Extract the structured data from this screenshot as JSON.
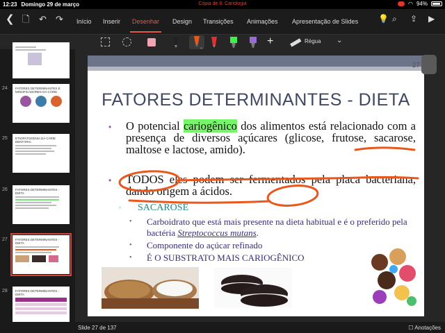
{
  "status": {
    "time": "12:23",
    "date": "Domingo 29 de março",
    "doc_title": "Cópia de 8. Cariologia",
    "battery": "94%"
  },
  "ribbon": {
    "tabs": [
      "Início",
      "Inserir",
      "Desenhar",
      "Design",
      "Transições",
      "Animações",
      "Apresentação de Slides"
    ],
    "active_tab": "Desenhar"
  },
  "toolbar": {
    "ruler_label": "Régua"
  },
  "thumbnails": [
    {
      "num": "",
      "title": "",
      "selected": false
    },
    {
      "num": "24",
      "title": "FATORES DETERMINANTES E MODIFICADORES DA CÁRIE",
      "selected": false
    },
    {
      "num": "25",
      "title": "ETIOPATOGENIA DA CÁRIE DENTÁRIA",
      "selected": false
    },
    {
      "num": "26",
      "title": "FATORES DETERMINANTES - DIETA",
      "selected": false
    },
    {
      "num": "27",
      "title": "FATORES DETERMINANTES - DIETA",
      "selected": true
    },
    {
      "num": "28",
      "title": "FATORES DETERMINANTES - DIETA",
      "selected": false
    }
  ],
  "slide": {
    "number": "27",
    "title": "FATORES DETERMINANTES - DIETA",
    "p1_before": "O potencial ",
    "p1_highlight": "cariogênico",
    "p1_after": " dos alimentos está relacionado com a presença de diversos açúcares (glicose, frutose, sacarose, maltose e lactose, amido).",
    "p2": "TODOS eles podem ser fermentados pela placa bacteriana, dando origem a ácidos.",
    "sub_heading": "SACAROSE",
    "sub_items": [
      {
        "pre": "Carboidrato que está mais presente na dieta habitual e é o preferido pela bactéria ",
        "em": "Streptococcus mutans",
        "post": "."
      },
      {
        "pre": "Componente do açúcar refinado",
        "em": "",
        "post": ""
      },
      {
        "pre": "É O SUBSTRATO MAIS CARIOGÊNICO",
        "em": "",
        "post": ""
      }
    ]
  },
  "footer": {
    "slide_counter": "Slide 27 de 137",
    "notes_label": "Anotações"
  },
  "colors": {
    "accent": "#e65a4b",
    "ink_orange": "#e8571c",
    "highlight_green": "#76f56a",
    "slide_title": "#3e4863"
  }
}
